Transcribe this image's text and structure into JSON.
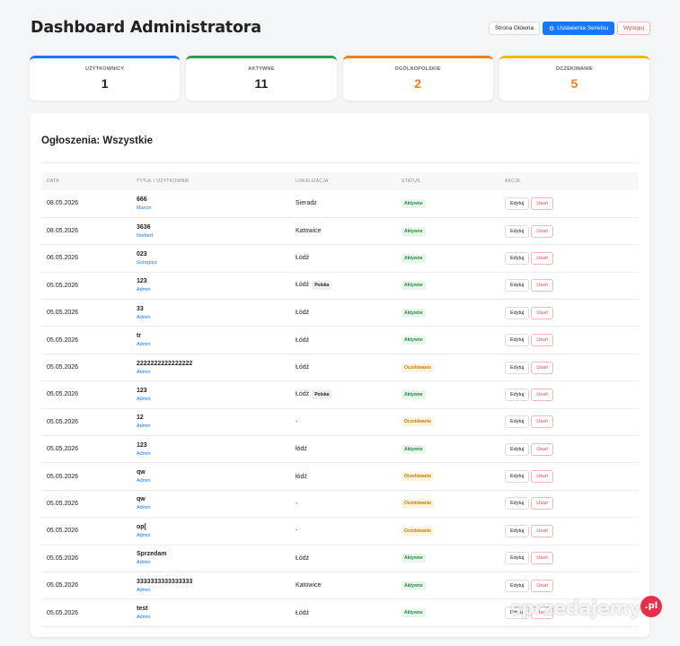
{
  "header": {
    "title": "Dashboard Administratora"
  },
  "buttons": {
    "home": "Strona Główna",
    "settings": "Ustawienia Serwisu",
    "logout": "Wyloguj"
  },
  "stats": [
    {
      "label": "UŻYTKOWNICY",
      "value": "1",
      "color": "#1677ff"
    },
    {
      "label": "AKTYWNE",
      "value": "11",
      "color": "#2a9d4a"
    },
    {
      "label": "OGÓLNOPOLSKIE",
      "value": "2",
      "color": "#f07e1c"
    },
    {
      "label": "OCZEKIWANIE",
      "value": "5",
      "color": "#f5b800"
    }
  ],
  "card": {
    "title": "Ogłoszenia: Wszystkie"
  },
  "table": {
    "headers": [
      "DATA",
      "TYTUŁ / UŻYTKOWNIK",
      "LOKALIZACJA",
      "STATUS",
      "AKCJE"
    ],
    "edit_label": "Edytuj",
    "delete_label": "Usuń",
    "rows": [
      {
        "date": "08.05.2026",
        "title": "666",
        "user": "Marcin",
        "location": "Sieradz",
        "badge": "",
        "status": "Aktywne"
      },
      {
        "date": "08.05.2026",
        "title": "3636",
        "user": "Norbert",
        "location": "Katowice",
        "badge": "",
        "status": "Aktywne"
      },
      {
        "date": "06.05.2026",
        "title": "023",
        "user": "Grzegorz",
        "location": "Łódź",
        "badge": "",
        "status": "Aktywne"
      },
      {
        "date": "05.05.2026",
        "title": "123",
        "user": "Admin",
        "location": "Łódź",
        "badge": "Polska",
        "status": "Aktywne"
      },
      {
        "date": "05.05.2026",
        "title": "33",
        "user": "Admin",
        "location": "Łódź",
        "badge": "",
        "status": "Aktywne"
      },
      {
        "date": "05.05.2026",
        "title": "tr",
        "user": "Admin",
        "location": "Łódź",
        "badge": "",
        "status": "Aktywne"
      },
      {
        "date": "05.05.2026",
        "title": "2222222222222222",
        "user": "Admin",
        "location": "Łódź",
        "badge": "",
        "status": "Oczekiwanie"
      },
      {
        "date": "05.05.2026",
        "title": "123",
        "user": "Admin",
        "location": "Łódź",
        "badge": "Polska",
        "status": "Aktywne"
      },
      {
        "date": "05.05.2026",
        "title": "12",
        "user": "Admin",
        "location": "-",
        "badge": "",
        "status": "Oczekiwanie"
      },
      {
        "date": "05.05.2026",
        "title": "123",
        "user": "Admin",
        "location": "łódź",
        "badge": "",
        "status": "Aktywne"
      },
      {
        "date": "05.05.2026",
        "title": "qw",
        "user": "Admin",
        "location": "łódź",
        "badge": "",
        "status": "Oczekiwanie"
      },
      {
        "date": "05.05.2026",
        "title": "qw",
        "user": "Admin",
        "location": "-",
        "badge": "",
        "status": "Oczekiwanie"
      },
      {
        "date": "05.05.2026",
        "title": "op[",
        "user": "Admin",
        "location": "-",
        "badge": "",
        "status": "Oczekiwanie"
      },
      {
        "date": "05.05.2026",
        "title": "Sprzedam",
        "user": "Admin",
        "location": "Łódź",
        "badge": "",
        "status": "Aktywne"
      },
      {
        "date": "05.05.2026",
        "title": "3333333333333333",
        "user": "Admin",
        "location": "Katowice",
        "badge": "",
        "status": "Aktywne"
      },
      {
        "date": "05.05.2026",
        "title": "test",
        "user": "Admin",
        "location": "Łódź",
        "badge": "",
        "status": "Aktywne"
      }
    ]
  },
  "watermark": {
    "text": "sprzedajemy",
    "suffix": ".pl"
  }
}
